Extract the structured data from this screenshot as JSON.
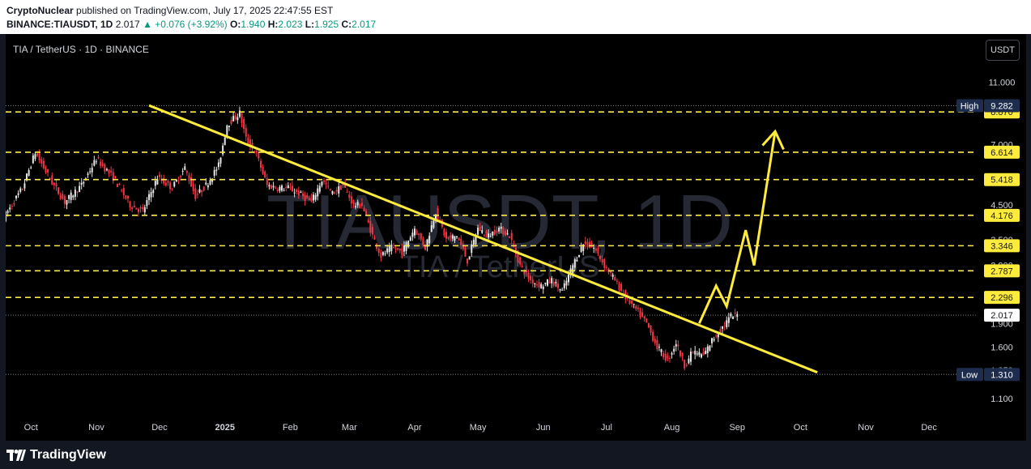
{
  "header": {
    "line1_author": "CryptoNuclear",
    "line1_rest": "published on TradingView.com, July 17, 2025 22:47:55 EST",
    "symbol": "BINANCE:TIAUSDT, 1D",
    "last": "2.017",
    "change": "▲ +0.076 (+3.92%)",
    "o_label": "O:",
    "o_value": "1.940",
    "h_label": "H:",
    "h_value": "2.023",
    "l_label": "L:",
    "l_value": "1.925",
    "c_label": "C:",
    "c_value": "2.017"
  },
  "chart_title": "TIA / TetherUS · 1D · BINANCE",
  "currency": "USDT",
  "watermark": {
    "main": "TIAUSDT, 1D",
    "sub": "TIA / TetherUS"
  },
  "footer": {
    "brand": "TradingView"
  },
  "colors": {
    "up": "#e6e6e6",
    "down": "#f23645",
    "trend": "#ffeb3b",
    "level": "#ffeb3b",
    "label_dark": "#131722",
    "low_high_bg": "#1e2d4d"
  },
  "chart_data": {
    "type": "candlestick",
    "title": "TIA / TetherUS · 1D · BINANCE",
    "y_scale": "log",
    "ylim": [
      1.0,
      12.0
    ],
    "y_ticks": [
      "11.000",
      "7.000",
      "4.500",
      "3.500",
      "2.900",
      "1.900",
      "1.600",
      "1.350",
      "1.100"
    ],
    "x_ticks": [
      "Oct",
      "Nov",
      "Dec",
      "2025",
      "Feb",
      "Mar",
      "Apr",
      "May",
      "Jun",
      "Jul",
      "Aug",
      "Sep",
      "Oct",
      "Nov",
      "Dec"
    ],
    "x_range": [
      "2024-09-19",
      "2025-12-24"
    ],
    "last_price": "2.017",
    "high": {
      "label": "High",
      "value": "9.282"
    },
    "low": {
      "label": "Low",
      "value": "1.310"
    },
    "resistance_levels": [
      "8.870",
      "6.614",
      "5.418",
      "4.176",
      "3.346",
      "2.787",
      "2.296"
    ],
    "trendline": [
      {
        "date": "2024-11-26",
        "price": 9.3
      },
      {
        "date": "2025-10-09",
        "price": 1.33
      }
    ],
    "projection": [
      {
        "date": "2025-08-14",
        "price": 1.9
      },
      {
        "date": "2025-08-22",
        "price": 2.5
      },
      {
        "date": "2025-08-27",
        "price": 2.15
      },
      {
        "date": "2025-09-05",
        "price": 3.75
      },
      {
        "date": "2025-09-09",
        "price": 2.9
      },
      {
        "date": "2025-09-19",
        "price": 7.7
      }
    ],
    "arrowhead": [
      {
        "date": "2025-09-13",
        "price": 6.95
      },
      {
        "date": "2025-09-19",
        "price": 7.7
      },
      {
        "date": "2025-09-23",
        "price": 6.75
      }
    ],
    "price_path": [
      {
        "date": "2024-09-19",
        "price": 4.1
      },
      {
        "date": "2024-09-28",
        "price": 5.1
      },
      {
        "date": "2024-10-04",
        "price": 6.6
      },
      {
        "date": "2024-10-12",
        "price": 5.3
      },
      {
        "date": "2024-10-18",
        "price": 4.6
      },
      {
        "date": "2024-10-26",
        "price": 5.2
      },
      {
        "date": "2024-11-02",
        "price": 6.3
      },
      {
        "date": "2024-11-10",
        "price": 5.5
      },
      {
        "date": "2024-11-18",
        "price": 4.5
      },
      {
        "date": "2024-11-24",
        "price": 4.3
      },
      {
        "date": "2024-12-01",
        "price": 5.5
      },
      {
        "date": "2024-12-08",
        "price": 5.1
      },
      {
        "date": "2024-12-14",
        "price": 5.9
      },
      {
        "date": "2024-12-19",
        "price": 4.8
      },
      {
        "date": "2024-12-24",
        "price": 5.2
      },
      {
        "date": "2024-12-30",
        "price": 6.0
      },
      {
        "date": "2025-01-03",
        "price": 8.1
      },
      {
        "date": "2025-01-09",
        "price": 8.8
      },
      {
        "date": "2025-01-12",
        "price": 7.3
      },
      {
        "date": "2025-01-17",
        "price": 6.5
      },
      {
        "date": "2025-01-22",
        "price": 5.2
      },
      {
        "date": "2025-01-27",
        "price": 5.1
      },
      {
        "date": "2025-02-01",
        "price": 5.1
      },
      {
        "date": "2025-02-06",
        "price": 4.9
      },
      {
        "date": "2025-02-12",
        "price": 4.6
      },
      {
        "date": "2025-02-17",
        "price": 5.4
      },
      {
        "date": "2025-02-22",
        "price": 4.9
      },
      {
        "date": "2025-02-27",
        "price": 5.2
      },
      {
        "date": "2025-03-04",
        "price": 4.5
      },
      {
        "date": "2025-03-08",
        "price": 4.5
      },
      {
        "date": "2025-03-13",
        "price": 3.6
      },
      {
        "date": "2025-03-17",
        "price": 3.1
      },
      {
        "date": "2025-03-22",
        "price": 3.3
      },
      {
        "date": "2025-03-27",
        "price": 3.2
      },
      {
        "date": "2025-04-02",
        "price": 3.8
      },
      {
        "date": "2025-04-07",
        "price": 3.3
      },
      {
        "date": "2025-04-12",
        "price": 4.3
      },
      {
        "date": "2025-04-17",
        "price": 3.5
      },
      {
        "date": "2025-04-22",
        "price": 3.6
      },
      {
        "date": "2025-04-27",
        "price": 3.0
      },
      {
        "date": "2025-05-02",
        "price": 3.8
      },
      {
        "date": "2025-05-07",
        "price": 3.6
      },
      {
        "date": "2025-05-12",
        "price": 3.8
      },
      {
        "date": "2025-05-17",
        "price": 3.6
      },
      {
        "date": "2025-05-22",
        "price": 2.9
      },
      {
        "date": "2025-05-27",
        "price": 2.6
      },
      {
        "date": "2025-06-01",
        "price": 2.5
      },
      {
        "date": "2025-06-06",
        "price": 2.6
      },
      {
        "date": "2025-06-11",
        "price": 2.4
      },
      {
        "date": "2025-06-16",
        "price": 2.9
      },
      {
        "date": "2025-06-21",
        "price": 3.4
      },
      {
        "date": "2025-06-26",
        "price": 3.3
      },
      {
        "date": "2025-07-01",
        "price": 2.9
      },
      {
        "date": "2025-07-06",
        "price": 2.6
      },
      {
        "date": "2025-07-11",
        "price": 2.3
      },
      {
        "date": "2025-07-16",
        "price": 2.1
      },
      {
        "date": "2025-07-21",
        "price": 1.9
      },
      {
        "date": "2025-07-26",
        "price": 1.6
      },
      {
        "date": "2025-07-31",
        "price": 1.45
      },
      {
        "date": "2025-08-04",
        "price": 1.65
      },
      {
        "date": "2025-08-08",
        "price": 1.4
      },
      {
        "date": "2025-08-12",
        "price": 1.55
      },
      {
        "date": "2025-08-17",
        "price": 1.5
      },
      {
        "date": "2025-08-21",
        "price": 1.68
      },
      {
        "date": "2025-08-26",
        "price": 1.85
      },
      {
        "date": "2025-08-30",
        "price": 2.0
      },
      {
        "date": "2025-09-02",
        "price": 2.017
      }
    ]
  }
}
